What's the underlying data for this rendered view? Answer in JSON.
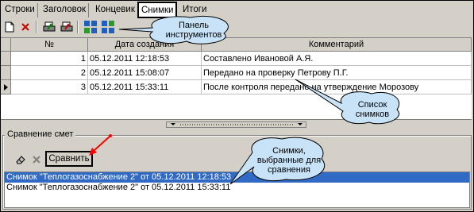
{
  "tabs": [
    {
      "label": "Строки"
    },
    {
      "label": "Заголовок"
    },
    {
      "label": "Концевик"
    },
    {
      "label": "Снимки"
    },
    {
      "label": "Итоги"
    }
  ],
  "grid": {
    "columns": {
      "num": "№",
      "date": "Дата создания",
      "comment": "Комментарий"
    },
    "rows": [
      {
        "num": "1",
        "date": "05.12.2011 12:18:53",
        "comment": "Составлено  Ивановой А.Я."
      },
      {
        "num": "2",
        "date": "05.12.2011 15:08:07",
        "comment": "Передано на проверку Петрову П.Г."
      },
      {
        "num": "3",
        "date": "05.12.2011 15:33:11",
        "comment": "После контроля передано на утверждение Морозову"
      }
    ]
  },
  "compare": {
    "group_label": "Сравнение смет",
    "button_label": "Сравнить",
    "items": [
      "Снимок \"Теплогазоснабжение 2\" от 05.12.2011 12:18:53",
      "Снимок \"Теплогазоснабжение 2\" от 05.12.2011 15:33:11"
    ]
  },
  "callouts": {
    "toolbar": "Панель инструментов",
    "list": "Список снимков",
    "selected": "Снимки, выбранные для сравнения"
  },
  "colors": {
    "selection": "#316ac5",
    "callout_fill": "#c8e3f8",
    "arrow": "#ff0000"
  },
  "icons": [
    "new-document-icon",
    "delete-icon",
    "print-green-icon",
    "print-red-icon",
    "snapshot-add-icon",
    "snapshot-refresh-icon",
    "eraser-icon",
    "delete-icon"
  ]
}
